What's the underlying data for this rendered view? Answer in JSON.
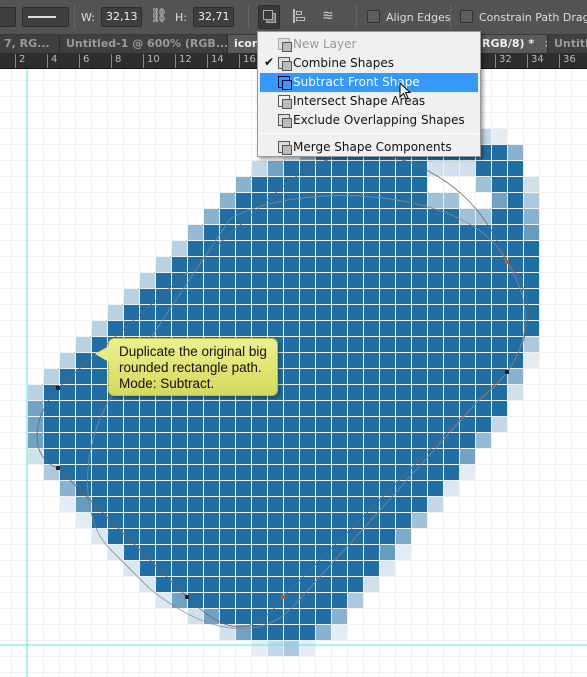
{
  "toolbar": {
    "w_label": "W:",
    "w_value": "32,13 px",
    "h_label": "H:",
    "h_value": "32,71 px",
    "align_edges": "Align Edges",
    "constrain": "Constrain Path Dragging"
  },
  "tabs": [
    {
      "label": "7, RG...",
      "close": "×"
    },
    {
      "label": "Untitled-1 @ 600% (RGB...",
      "close": "×"
    },
    {
      "label": "icon",
      "close": ""
    },
    {
      "label": "RGB/8) *",
      "close": "×"
    },
    {
      "label": "Untitle",
      "close": ""
    }
  ],
  "ruler": [
    "2",
    "4",
    "6",
    "8",
    "10",
    "12",
    "14",
    "16",
    "32",
    "34",
    "36"
  ],
  "menu": {
    "items": [
      {
        "label": "New Layer",
        "disabled": true
      },
      {
        "label": "Combine Shapes",
        "checked": true
      },
      {
        "label": "Subtract Front Shape",
        "highlighted": true
      },
      {
        "label": "Intersect Shape Areas"
      },
      {
        "label": "Exclude Overlapping Shapes"
      },
      {
        "label": "Merge Shape Components"
      }
    ]
  },
  "tooltip": {
    "line1": "Duplicate the original big",
    "line2": "rounded rectangle path.",
    "line3": "Mode: Subtract."
  },
  "colors": {
    "shape": "#1f6fa6",
    "guide": "#4ee6ee",
    "menu_highlight": "#3399ff"
  }
}
